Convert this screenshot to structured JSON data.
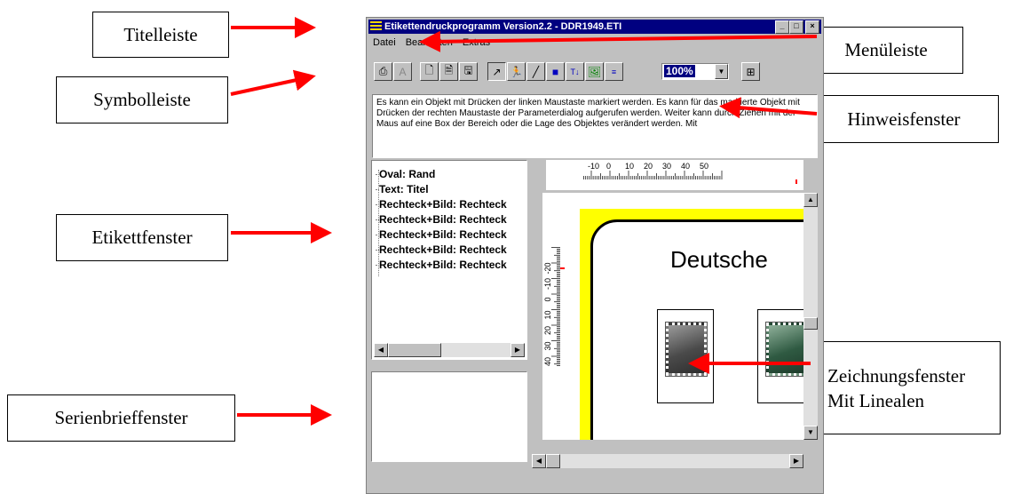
{
  "window": {
    "title": "Etikettendruckprogramm Version2.2 - DDR1949.ETI",
    "controls": [
      "_",
      "□",
      "×"
    ]
  },
  "menu": [
    "Datei",
    "Bearbeiten",
    "Extras"
  ],
  "toolbar": {
    "zoom": "100%"
  },
  "hint_text": "Es kann ein Objekt mit Drücken der linken Maustaste markiert werden. Es kann für das markierte Objekt mit Drücken der rechten Maustaste der Parameterdialog aufgerufen werden. Weiter kann durch Ziehen mit der Maus auf eine Box der Bereich oder die Lage des Objektes verändert werden. Mit",
  "tree_items": [
    "Oval: Rand",
    "Text: Titel",
    "Rechteck+Bild: Rechteck",
    "Rechteck+Bild: Rechteck",
    "Rechteck+Bild: Rechteck",
    "Rechteck+Bild: Rechteck",
    "Rechteck+Bild: Rechteck"
  ],
  "ruler": {
    "h_labels": [
      "-10",
      "0",
      "10",
      "20",
      "30",
      "40",
      "50"
    ],
    "v_labels": [
      "-20",
      "-10",
      "0",
      "10",
      "20",
      "30",
      "40"
    ]
  },
  "canvas": {
    "label_text": "Deutsche"
  },
  "callouts": {
    "titelleiste": "Titelleiste",
    "symbolleiste": "Symbolleiste",
    "etikettfenster": "Etikettfenster",
    "serienbrieffenster": "Serienbrieffenster",
    "menueleiste": "Menüleiste",
    "hinweisfenster": "Hinweisfenster",
    "zeichnung_line1": "Zeichnungsfenster",
    "zeichnung_line2": "Mit Linealen"
  },
  "colors": {
    "arrow": "#ff0000",
    "titlebar": "#000080",
    "canvas_border": "#ffff00"
  }
}
